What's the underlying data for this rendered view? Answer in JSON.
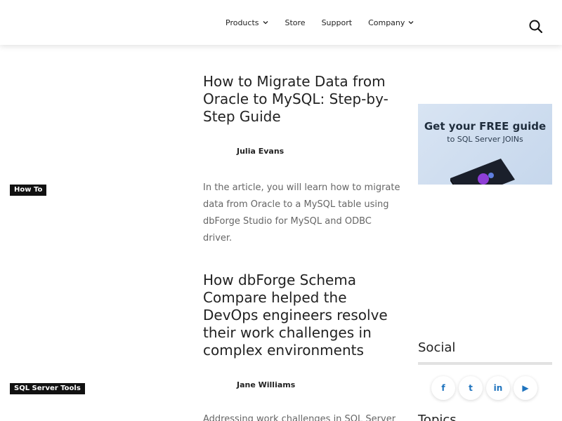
{
  "header": {
    "nav": [
      {
        "label": "Products",
        "has_dropdown": true
      },
      {
        "label": "Store",
        "has_dropdown": false
      },
      {
        "label": "Support",
        "has_dropdown": false
      },
      {
        "label": "Company",
        "has_dropdown": true
      }
    ],
    "search_icon": "search-icon"
  },
  "articles": [
    {
      "category": "How To",
      "title": "How to Migrate Data from Oracle to MySQL: Step-by-Step Guide",
      "author": "Julia Evans",
      "excerpt": "In the article, you will learn how to migrate data from Oracle to a MySQL table using dbForge Studio for MySQL and ODBC driver."
    },
    {
      "category": "SQL Server Tools",
      "title": "How dbForge Schema Compare helped the DevOps engineers resolve their work challenges in complex environments",
      "author": "Jane Williams",
      "excerpt": "Addressing work challenges in SQL Server"
    }
  ],
  "sidebar": {
    "promo": {
      "title": "Get your FREE guide",
      "subtitle": "to SQL Server JOINs"
    },
    "social_heading": "Social",
    "social": [
      {
        "icon": "facebook-icon",
        "glyph": "f"
      },
      {
        "icon": "twitter-icon",
        "glyph": "t"
      },
      {
        "icon": "linkedin-icon",
        "glyph": "in"
      },
      {
        "icon": "youtube-icon",
        "glyph": "▶"
      }
    ],
    "topics_heading": "Topics"
  },
  "colors": {
    "accent": "#1e73be",
    "tag_bg": "#111111",
    "promo_bg": "#cddcee"
  }
}
